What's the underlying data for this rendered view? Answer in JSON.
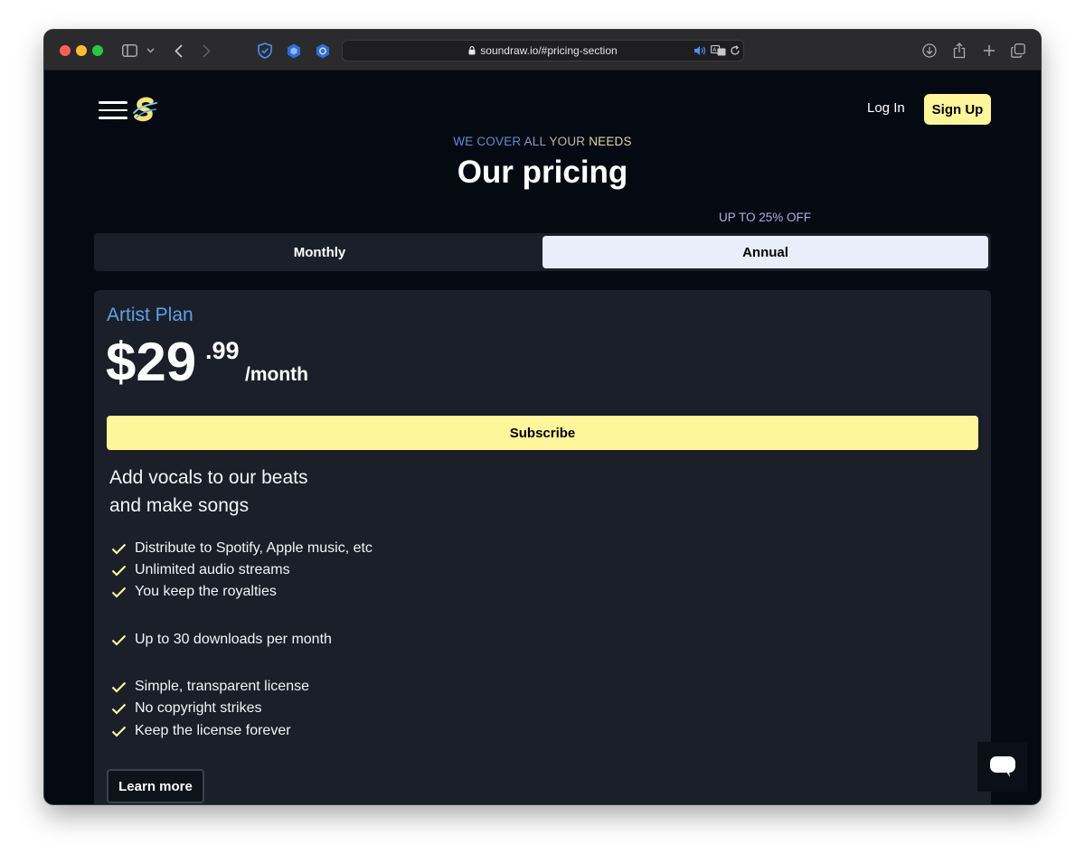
{
  "browser": {
    "url": "soundraw.io/#pricing-section"
  },
  "header": {
    "login_label": "Log In",
    "signup_label": "Sign Up"
  },
  "hero": {
    "eyebrow_1": "WE COVER",
    "eyebrow_2": "ALL",
    "eyebrow_3": "YOUR",
    "eyebrow_4": "NEEDS",
    "title": "Our pricing"
  },
  "billing": {
    "discount_label": "UP TO 25% OFF",
    "monthly_label": "Monthly",
    "annual_label": "Annual",
    "selected": "Annual"
  },
  "plan": {
    "name": "Artist Plan",
    "price_main": "$29",
    "price_cents": ".99",
    "price_period": "/month",
    "subscribe_label": "Subscribe",
    "tagline_line1": "Add vocals to our beats",
    "tagline_line2": "and make songs",
    "features": [
      "Distribute to Spotify, Apple music, etc",
      "Unlimited audio streams",
      "You keep the royalties",
      "Up to 30 downloads per month",
      "Simple, transparent license",
      "No copyright strikes",
      "Keep the license forever"
    ],
    "learn_more_label": "Learn more"
  },
  "colors": {
    "accent_yellow": "#fff59a",
    "plan_blue": "#5ea2e6",
    "page_bg": "#050a12",
    "card_bg": "#1a1f29"
  },
  "icons": {
    "menu": "hamburger-icon",
    "logo": "soundraw-logo",
    "check": "check-icon",
    "chat": "chat-bubble-icon"
  }
}
